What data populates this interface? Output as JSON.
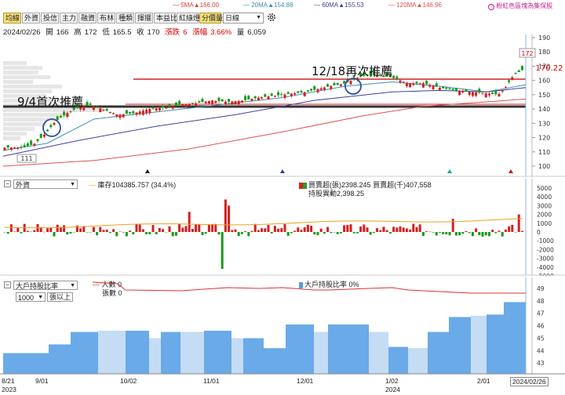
{
  "legend": {
    "ma5": {
      "label": "5MA",
      "value": "▲166.00",
      "color": "#d94040"
    },
    "ma20": {
      "label": "20MA",
      "value": "▲154.88",
      "color": "#3a8fb0"
    },
    "ma60": {
      "label": "60MA",
      "value": "▲155.53",
      "color": "#4040a0"
    },
    "ma120": {
      "label": "120MA",
      "value": "▲146.96",
      "color": "#e05050"
    },
    "link": "粉紅色區塊為集保股"
  },
  "toolbar": {
    "tabs": [
      "均線",
      "外資",
      "投信",
      "主力",
      "融資",
      "布林",
      "種類",
      "揮擺",
      "本益比",
      "紅綠燈",
      "分價量"
    ],
    "period": "日線",
    "gear_icon": "gear-icon"
  },
  "info": {
    "date": "2024/02/26",
    "open_label": "開",
    "open": "166",
    "high_label": "高",
    "high": "172",
    "low_label": "低",
    "low": "165.5",
    "close_label": "收",
    "close": "170",
    "change_label": "漲跌",
    "change": "6",
    "pct_label": "漲幅",
    "pct": "3.66%",
    "vol_label": "量",
    "vol": "6,059"
  },
  "price_panel": {
    "y_ticks": [
      "190",
      "180",
      "170",
      "160",
      "150",
      "140",
      "130",
      "120",
      "110",
      "100"
    ],
    "current_price": "170.22",
    "high_marker": "172",
    "low_marker": "111",
    "annotation_first": "9/4首次推薦",
    "annotation_second": "12/18再次推薦"
  },
  "foreign_panel": {
    "selector": "外資",
    "legend_stock": "庫存104385.757 (34.4%)",
    "legend_buysell_lots": "買賣超(張)2398.245",
    "legend_buysell_amount": "買賣超(千)407,558",
    "legend_holding_change": "持股異動2,398.25",
    "y_ticks": [
      "5000",
      "4000",
      "3000",
      "2000",
      "1000",
      "0",
      "-1000",
      "-2000",
      "-3000",
      "-4000",
      "-5000"
    ]
  },
  "holder_panel": {
    "selector": "大戶持股比率",
    "threshold": "1000",
    "threshold_suffix": "張以上",
    "legend_people": "人數 0",
    "legend_lots": "張數 0",
    "legend_ratio": "大戶持股比率 0%",
    "y_ticks": [
      "49",
      "48",
      "47",
      "46",
      "45",
      "44",
      "43"
    ]
  },
  "x_axis": {
    "labels": [
      "8/21",
      "9/01",
      "10/02",
      "11/01",
      "12/01",
      "1/02",
      "2/01",
      "2024/02/26"
    ],
    "years": [
      "2023",
      "2024"
    ]
  }
}
